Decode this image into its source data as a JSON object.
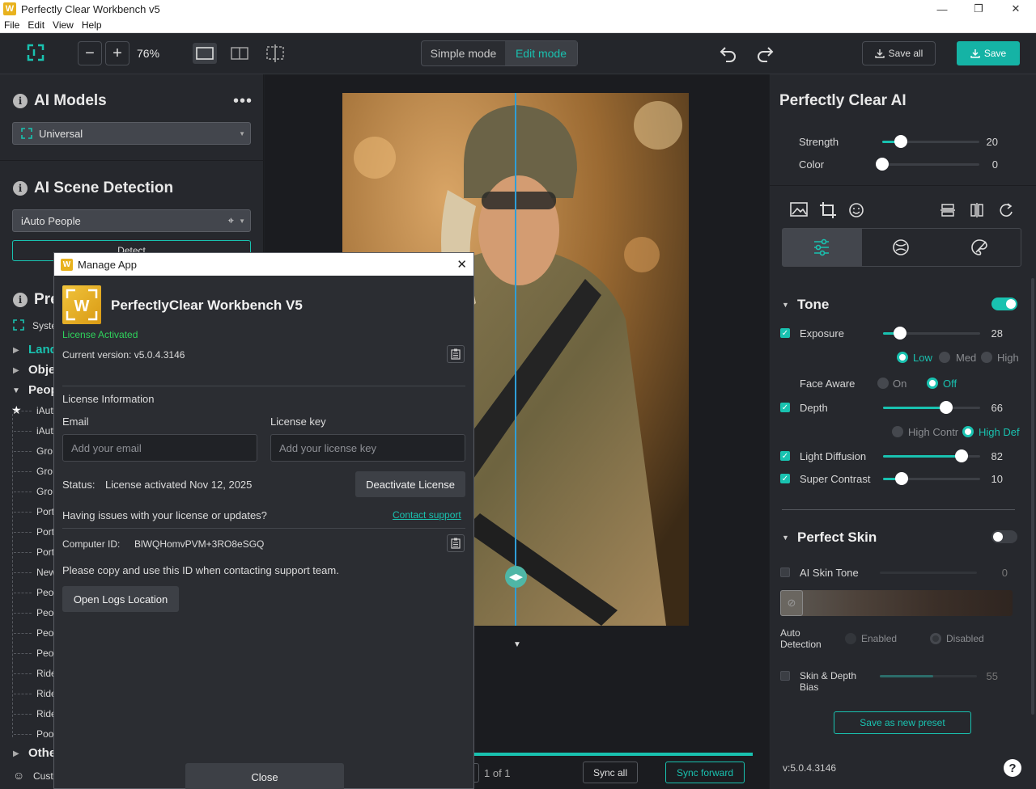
{
  "window": {
    "title": "Perfectly Clear Workbench v5",
    "icon_letter": "W"
  },
  "menu": [
    "File",
    "Edit",
    "View",
    "Help"
  ],
  "toolbar": {
    "zoom": "76%",
    "modes": {
      "simple": "Simple mode",
      "edit": "Edit mode"
    },
    "save_all": "Save all",
    "save": "Save"
  },
  "left": {
    "ai_models": {
      "title": "AI Models",
      "selected": "Universal"
    },
    "scene": {
      "title": "AI Scene Detection",
      "selected": "iAuto People",
      "detect": "Detect"
    },
    "presets": {
      "title": "Pre",
      "system": "Syste",
      "categories": [
        "Land",
        "Obje",
        "Peop"
      ],
      "items": [
        "iAut",
        "iAut",
        "Gro",
        "Gro",
        "Gro",
        "Port",
        "Port",
        "Port",
        "New",
        "Peo",
        "Peo",
        "Peo",
        "Peo",
        "Ride",
        "Ride",
        "Ride",
        "Poo"
      ],
      "other": "Othe",
      "custom": "Cust"
    }
  },
  "canvas": {
    "page": "1 of 1",
    "sync_all": "Sync all",
    "sync_forward": "Sync forward",
    "split_fraction": 0.5
  },
  "right": {
    "title": "Perfectly Clear AI",
    "strength": {
      "label": "Strength",
      "value": 20
    },
    "color": {
      "label": "Color",
      "value": 0
    },
    "tone": {
      "title": "Tone",
      "enabled": true,
      "exposure": {
        "label": "Exposure",
        "value": 28,
        "options": [
          "Low",
          "Med",
          "High"
        ],
        "selected": "Low"
      },
      "face_aware": {
        "label": "Face Aware",
        "options": [
          "On",
          "Off"
        ],
        "selected": "Off"
      },
      "depth": {
        "label": "Depth",
        "value": 66,
        "options": [
          "High Contr",
          "High Def"
        ],
        "selected": "High Def"
      },
      "light_diffusion": {
        "label": "Light Diffusion",
        "value": 82
      },
      "super_contrast": {
        "label": "Super Contrast",
        "value": 10
      }
    },
    "skin": {
      "title": "Perfect Skin",
      "enabled": false,
      "ai_skin_tone": {
        "label": "AI Skin Tone",
        "value": 0
      },
      "auto_detection": {
        "label_1": "Auto",
        "label_2": "Detection",
        "options": [
          "Enabled",
          "Disabled"
        ],
        "selected": "Disabled"
      },
      "skin_depth": {
        "label_1": "Skin & Depth",
        "label_2": "Bias",
        "value": 55
      }
    },
    "save_preset": "Save as new preset",
    "version": "v:5.0.4.3146",
    "help": "?"
  },
  "dialog": {
    "title": "Manage App",
    "app_name": "PerfectlyClear Workbench V5",
    "license_status": "License Activated",
    "current_version": "Current version: v5.0.4.3146",
    "license_info": "License Information",
    "email_label": "Email",
    "email_placeholder": "Add your email",
    "key_label": "License key",
    "key_placeholder": "Add your license key",
    "status_label": "Status:",
    "status_value": "License activated Nov 12, 2025",
    "deactivate": "Deactivate License",
    "issues": "Having issues with your license or updates?",
    "contact": "Contact support",
    "computer_id_label": "Computer ID:",
    "computer_id": "BlWQHomvPVM+3RO8eSGQ",
    "copy_note": "Please copy and use this ID when contacting support team.",
    "open_logs": "Open Logs Location",
    "close": "Close"
  }
}
